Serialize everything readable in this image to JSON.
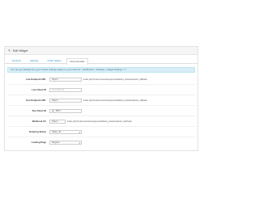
{
  "panel": {
    "title": "Edit Widget",
    "tabs": [
      "General",
      "Settings",
      "Order Status",
      "Setup Emails"
    ],
    "active_tab_index": 3
  },
  "alert": {
    "text": "You can get settings from your stored settings widget on your account > dashboard > Settings > widget Settings > ?"
  },
  "fields": [
    {
      "label": "Live Endpoint URL",
      "value": "https://",
      "suffix": "index.php?route=extension/payment/klarna_checkout/push_callback"
    },
    {
      "label": "Live Client ID",
      "value": "",
      "placeholder": "Live Client ID"
    },
    {
      "label": "Test Endpoint URL",
      "value": "https://",
      "suffix": "index.php?route=extension/payment/klarna_checkout/push_callback"
    },
    {
      "label": "Test Client ID",
      "value": "ap_TEST"
    },
    {
      "label": "Webhook Url",
      "value": "https://",
      "suffix": "index.php?route=extension/payment/klarna_checkout/push_webhook"
    },
    {
      "label": "Ordering Status",
      "value": "Status_ID"
    },
    {
      "label": "Landing Page",
      "value": "Register"
    }
  ],
  "colors": {
    "link": "#1e91cf",
    "alert_bg": "#d9edf7",
    "alert_text": "#31708f"
  },
  "icons": {
    "panel_icon": "pencil-icon",
    "select_caret": "chevron-down-icon"
  }
}
